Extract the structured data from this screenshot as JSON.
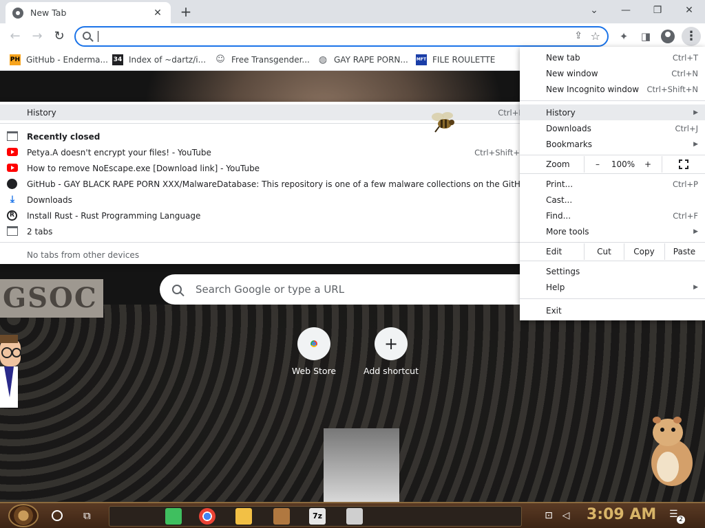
{
  "tab": {
    "title": "New Tab",
    "close": "✕"
  },
  "window": {
    "new_tab": "+",
    "tab_search": "⌄",
    "minimize": "—",
    "restore": "❐",
    "close": "✕"
  },
  "toolbar": {
    "back": "←",
    "forward": "→",
    "reload": "↻",
    "omnibox_value": "",
    "share": "⇪",
    "star": "☆",
    "extensions": "✦",
    "side_panel": "◨",
    "menu": "⋮"
  },
  "bookmarks": [
    {
      "label": "GitHub - Enderma...",
      "icon": "ph-icon",
      "icon_text": "PH",
      "color": "#f7a41d"
    },
    {
      "label": "Index of ~dartz/i...",
      "icon": "index-icon",
      "icon_text": "34",
      "color": "#202124"
    },
    {
      "label": "Free Transgender...",
      "icon": "person-icon",
      "icon_text": "☺",
      "color": "#5f6368"
    },
    {
      "label": "GAY RAPE PORN...",
      "icon": "globe-icon",
      "icon_text": "◍",
      "color": "#5f6368"
    },
    {
      "label": "FILE ROULETTE",
      "icon": "mft-icon",
      "icon_text": "MFT",
      "color": "#1a3ea8"
    }
  ],
  "ntp": {
    "sign": "GSOC",
    "search_placeholder": "Search Google or type a URL",
    "shortcuts": [
      {
        "label": "Web Store",
        "icon": "web-store-icon"
      },
      {
        "label": "Add shortcut",
        "icon": "plus-icon"
      }
    ]
  },
  "menu": {
    "items": [
      {
        "label": "New tab",
        "shortcut": "Ctrl+T"
      },
      {
        "label": "New window",
        "shortcut": "Ctrl+N"
      },
      {
        "label": "New Incognito window",
        "shortcut": "Ctrl+Shift+N"
      },
      {
        "label": "History",
        "shortcut": "",
        "submenu": true,
        "highlighted": true
      },
      {
        "label": "Downloads",
        "shortcut": "Ctrl+J"
      },
      {
        "label": "Bookmarks",
        "shortcut": "",
        "submenu": true
      },
      {
        "label": "Print...",
        "shortcut": "Ctrl+P"
      },
      {
        "label": "Cast...",
        "shortcut": ""
      },
      {
        "label": "Find...",
        "shortcut": "Ctrl+F"
      },
      {
        "label": "More tools",
        "shortcut": "",
        "submenu": true
      },
      {
        "label": "Settings",
        "shortcut": ""
      },
      {
        "label": "Help",
        "shortcut": "",
        "submenu": true
      },
      {
        "label": "Exit",
        "shortcut": ""
      }
    ],
    "zoom": {
      "label": "Zoom",
      "minus": "–",
      "value": "100%",
      "plus": "+"
    },
    "edit": {
      "label": "Edit",
      "cut": "Cut",
      "copy": "Copy",
      "paste": "Paste"
    },
    "arrow": "▶"
  },
  "history": {
    "header": {
      "label": "History",
      "shortcut": "Ctrl+H"
    },
    "items": [
      {
        "label": "Recently closed",
        "shortcut": "",
        "icon": "window-icon",
        "bold": true
      },
      {
        "label": "Petya.A doesn't encrypt your files! - YouTube",
        "shortcut": "Ctrl+Shift+T",
        "icon": "youtube-icon"
      },
      {
        "label": "How to remove NoEscape.exe [Download link] - YouTube",
        "shortcut": "",
        "icon": "youtube-icon"
      },
      {
        "label": "GitHub - GAY BLACK RAPE PORN XXX/MalwareDatabase: This repository is one of a few malware collections on the GitHub.",
        "shortcut": "",
        "icon": "github-icon"
      },
      {
        "label": "Downloads",
        "shortcut": "",
        "icon": "download-icon"
      },
      {
        "label": "Install Rust - Rust Programming Language",
        "shortcut": "",
        "icon": "rust-icon"
      },
      {
        "label": "2 tabs",
        "shortcut": "",
        "icon": "window-icon",
        "submenu": true
      }
    ],
    "footer": "No tabs from other devices"
  },
  "taskbar": {
    "clock": "3:09 AM",
    "notification_count": "2",
    "apps": [
      {
        "name": "notes-app-icon",
        "color": "#3fbf5f"
      },
      {
        "name": "chrome-icon",
        "color": "#4285f4"
      },
      {
        "name": "file-explorer-icon",
        "color": "#f2c045"
      },
      {
        "name": "bonzi-icon",
        "color": "#b07840"
      },
      {
        "name": "7zip-icon",
        "color": "#e6e6e6"
      },
      {
        "name": "window-app-icon",
        "color": "#cfcfcf"
      }
    ]
  }
}
